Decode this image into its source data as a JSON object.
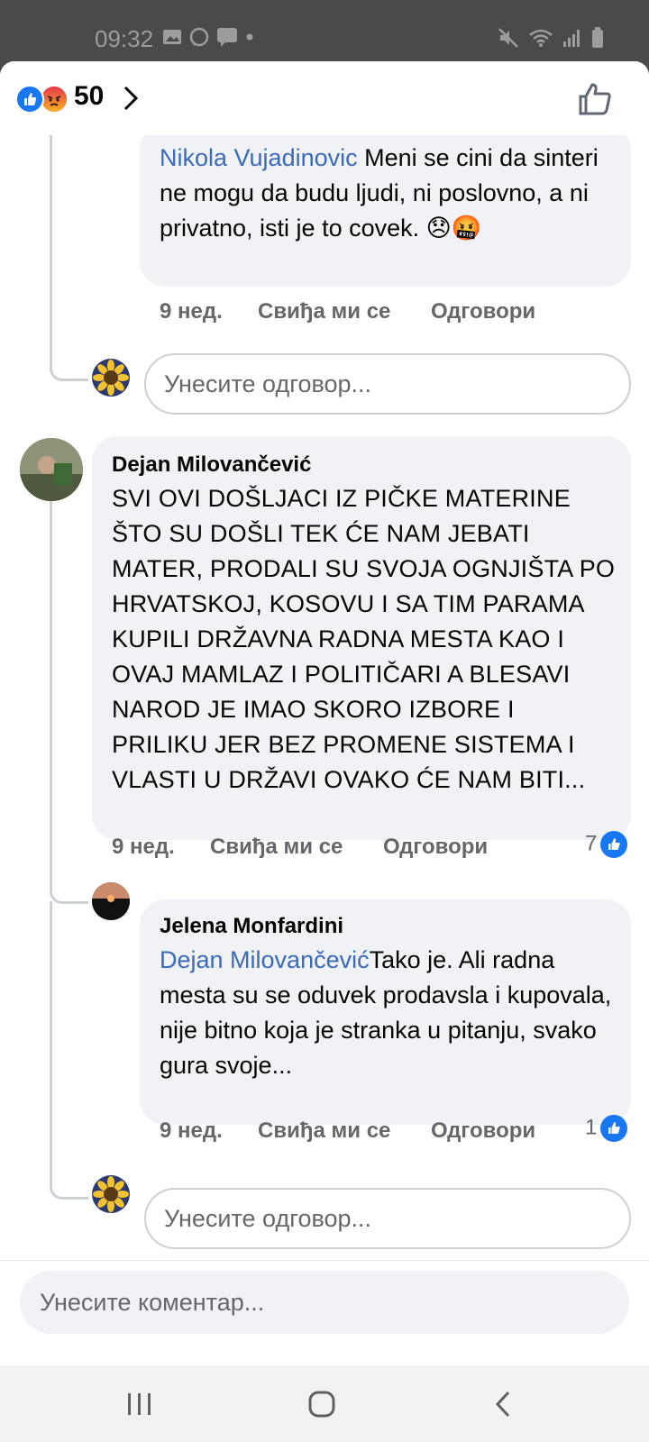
{
  "status_bar": {
    "time": "09:32"
  },
  "header": {
    "reaction_count": "50"
  },
  "comments": [
    {
      "name": "Nikola Vujadinovic",
      "mention": "",
      "text": " Meni se cini da sinteri ne mogu da budu ljudi, ni poslovno, a ni privatno, isti je to covek. 😞🤬",
      "time": "9 нед.",
      "like_label": "Свиђа ми се",
      "reply_label": "Одговори"
    },
    {
      "name": "Dejan Milovančević",
      "text": "SVI OVI DOŠLJACI IZ PIČKE MATERINE ŠTO SU DOŠLI TEK ĆE NAM JEBATI MATER, PRODALI SU SVOJA OGNJIŠTA PO HRVATSKOJ, KOSOVU I SA TIM PARAMA KUPILI DRŽAVNA RADNA MESTA KAO I OVAJ MAMLAZ I POLITIČARI A BLESAVI NAROD JE IMAO SKORO IZBORE I PRILIKU JER BEZ PROMENE SISTEMA I VLASTI U DRŽAVI OVAKO ĆE NAM BITI...",
      "time": "9 нед.",
      "like_label": "Свиђа ми се",
      "reply_label": "Одговори",
      "likes": "7"
    },
    {
      "name": "Jelena Monfardini",
      "mention": "Dejan Milovančević",
      "text": "Tako je. Ali radna mesta su se oduvek prodavsla i kupovala, nije bitno koja je stranka u pitanju, svako gura svoje...",
      "time": "9 нед.",
      "like_label": "Свиђа ми се",
      "reply_label": "Одговори",
      "likes": "1"
    }
  ],
  "reply_placeholder": "Унесите одговор...",
  "comment_placeholder": "Унесите коментар...",
  "colors": {
    "accent": "#1877f2",
    "mention": "#3b6bb8",
    "bubble": "#f0f2f5"
  }
}
